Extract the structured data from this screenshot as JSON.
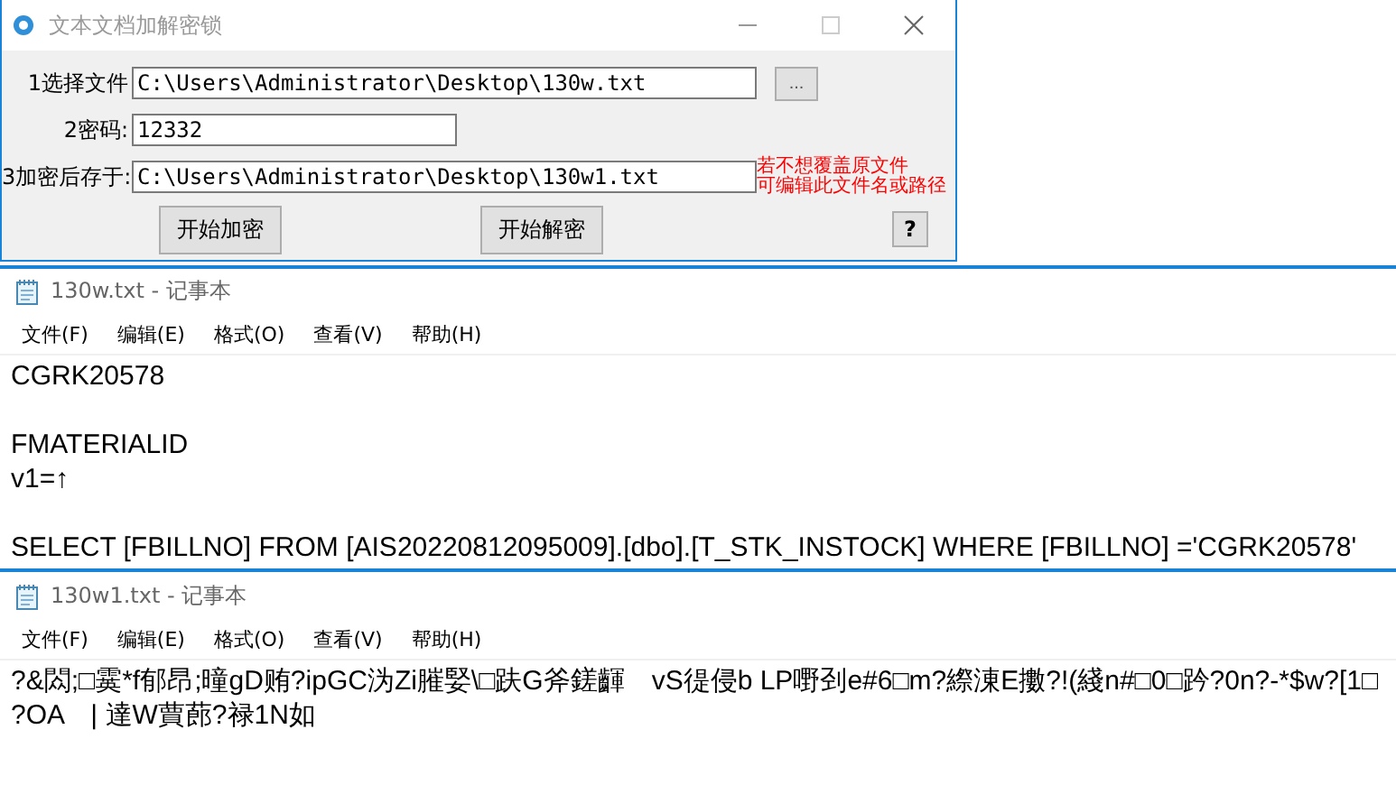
{
  "dialog": {
    "title": "文本文档加解密锁",
    "fields": [
      {
        "label": "1选择文件",
        "value": "C:\\Users\\Administrator\\Desktop\\130w.txt",
        "browse": "..."
      },
      {
        "label": "2密码:",
        "value": "12332"
      },
      {
        "label": "3加密后存于:",
        "value": "C:\\Users\\Administrator\\Desktop\\130w1.txt",
        "note": [
          "若不想覆盖原文件",
          "可编辑此文件名或路径"
        ]
      }
    ],
    "buttons": [
      "开始加密",
      "开始解密"
    ],
    "help": "?"
  },
  "notepads": [
    {
      "title": "130w.txt - 记事本",
      "menu": [
        "文件(F)",
        "编辑(E)",
        "格式(O)",
        "查看(V)",
        "帮助(H)"
      ],
      "paragraphs": [
        [
          "CGRK20578"
        ],
        [
          "FMATERIALID",
          "v1=↑"
        ],
        [
          "SELECT [FBILLNO] FROM [AIS20220812095009].[dbo].[T_STK_INSTOCK] WHERE [FBILLNO] ='CGRK20578'"
        ]
      ]
    },
    {
      "title": "130w1.txt - 记事本",
      "menu": [
        "文件(F)",
        "编辑(E)",
        "格式(O)",
        "查看(V)",
        "帮助(H)"
      ],
      "paragraphs": [
        [
          "?&閦;□霙*f郁昂;曈gD贿?ipGC沩Zi膗婜\\□趺G斧鎈齳　vS徥侵b LP嘢刭e#6□m?縩涷E擻?!(綫n#□0□趻?0n?-*$w?[1□",
          "?OA　| 達W蕒蓢?禄1N如"
        ]
      ]
    }
  ]
}
